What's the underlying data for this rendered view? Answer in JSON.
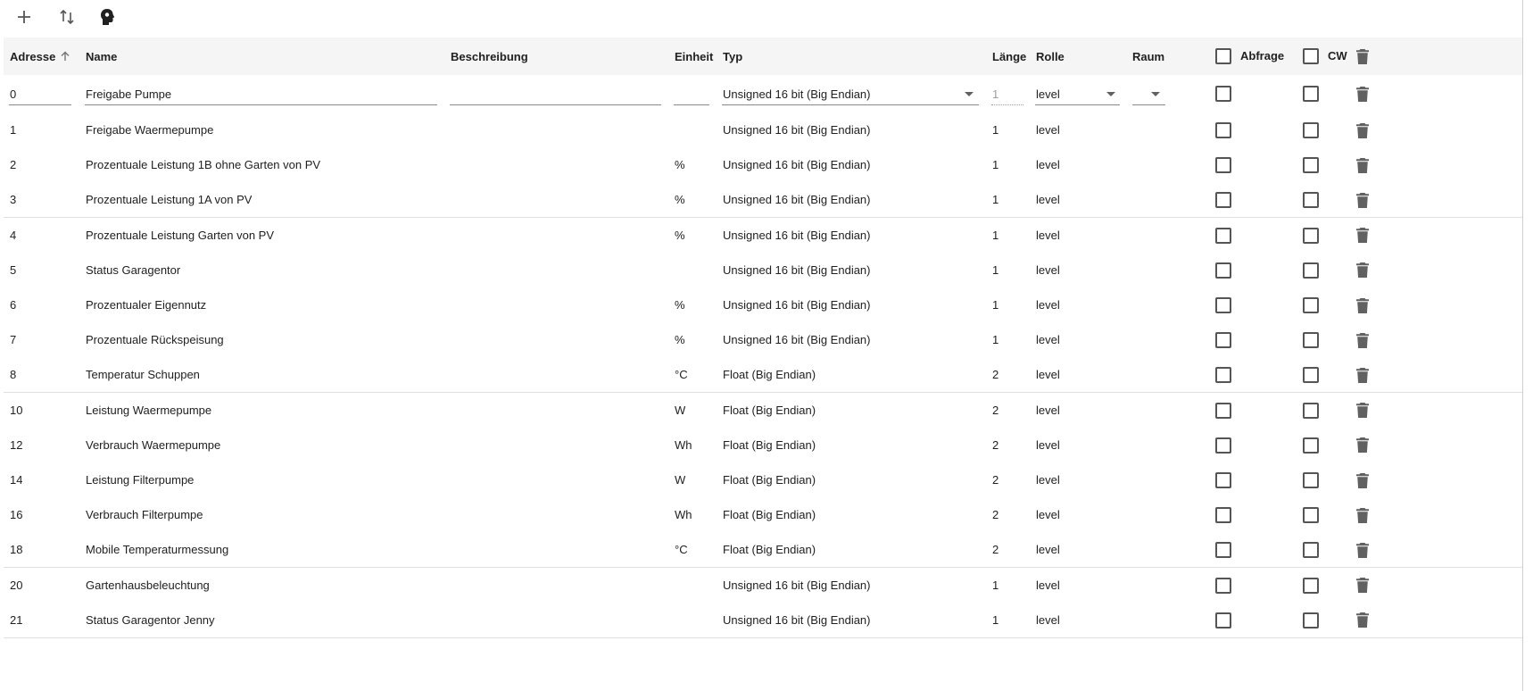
{
  "toolbar": {
    "icons": [
      "add-icon",
      "sort-icon",
      "head-icon"
    ]
  },
  "columns": {
    "address": "Adresse",
    "name": "Name",
    "description": "Beschreibung",
    "unit": "Einheit",
    "type": "Typ",
    "length": "Länge",
    "role": "Rolle",
    "room": "Raum",
    "poll": "Abfrage",
    "cw": "CW"
  },
  "edit_row": {
    "address": "0",
    "name": "Freigabe Pumpe",
    "description": "",
    "unit": "",
    "type": "Unsigned 16 bit (Big Endian)",
    "length": "1",
    "role": "level",
    "room": ""
  },
  "rows": [
    {
      "address": "1",
      "name": "Freigabe Waermepumpe",
      "unit": "",
      "type": "Unsigned 16 bit (Big Endian)",
      "length": "1",
      "role": "level"
    },
    {
      "address": "2",
      "name": "Prozentuale Leistung 1B ohne Garten von PV",
      "unit": "%",
      "type": "Unsigned 16 bit (Big Endian)",
      "length": "1",
      "role": "level"
    },
    {
      "address": "3",
      "name": "Prozentuale Leistung 1A von PV",
      "unit": "%",
      "type": "Unsigned 16 bit (Big Endian)",
      "length": "1",
      "role": "level"
    },
    {
      "address": "4",
      "name": "Prozentuale Leistung Garten von PV",
      "unit": "%",
      "type": "Unsigned 16 bit (Big Endian)",
      "length": "1",
      "role": "level"
    },
    {
      "address": "5",
      "name": "Status Garagentor",
      "unit": "",
      "type": "Unsigned 16 bit (Big Endian)",
      "length": "1",
      "role": "level"
    },
    {
      "address": "6",
      "name": "Prozentualer Eigennutz",
      "unit": "%",
      "type": "Unsigned 16 bit (Big Endian)",
      "length": "1",
      "role": "level"
    },
    {
      "address": "7",
      "name": "Prozentuale Rückspeisung",
      "unit": "%",
      "type": "Unsigned 16 bit (Big Endian)",
      "length": "1",
      "role": "level"
    },
    {
      "address": "8",
      "name": "Temperatur Schuppen",
      "unit": "°C",
      "type": "Float (Big Endian)",
      "length": "2",
      "role": "level"
    },
    {
      "address": "10",
      "name": "Leistung Waermepumpe",
      "unit": "W",
      "type": "Float (Big Endian)",
      "length": "2",
      "role": "level"
    },
    {
      "address": "12",
      "name": "Verbrauch Waermepumpe",
      "unit": "Wh",
      "type": "Float (Big Endian)",
      "length": "2",
      "role": "level"
    },
    {
      "address": "14",
      "name": "Leistung Filterpumpe",
      "unit": "W",
      "type": "Float (Big Endian)",
      "length": "2",
      "role": "level"
    },
    {
      "address": "16",
      "name": "Verbrauch Filterpumpe",
      "unit": "Wh",
      "type": "Float (Big Endian)",
      "length": "2",
      "role": "level"
    },
    {
      "address": "18",
      "name": "Mobile Temperaturmessung",
      "unit": "°C",
      "type": "Float (Big Endian)",
      "length": "2",
      "role": "level"
    },
    {
      "address": "20",
      "name": "Gartenhausbeleuchtung",
      "unit": "",
      "type": "Unsigned 16 bit (Big Endian)",
      "length": "1",
      "role": "level"
    },
    {
      "address": "21",
      "name": "Status Garagentor Jenny",
      "unit": "",
      "type": "Unsigned 16 bit (Big Endian)",
      "length": "1",
      "role": "level"
    }
  ]
}
